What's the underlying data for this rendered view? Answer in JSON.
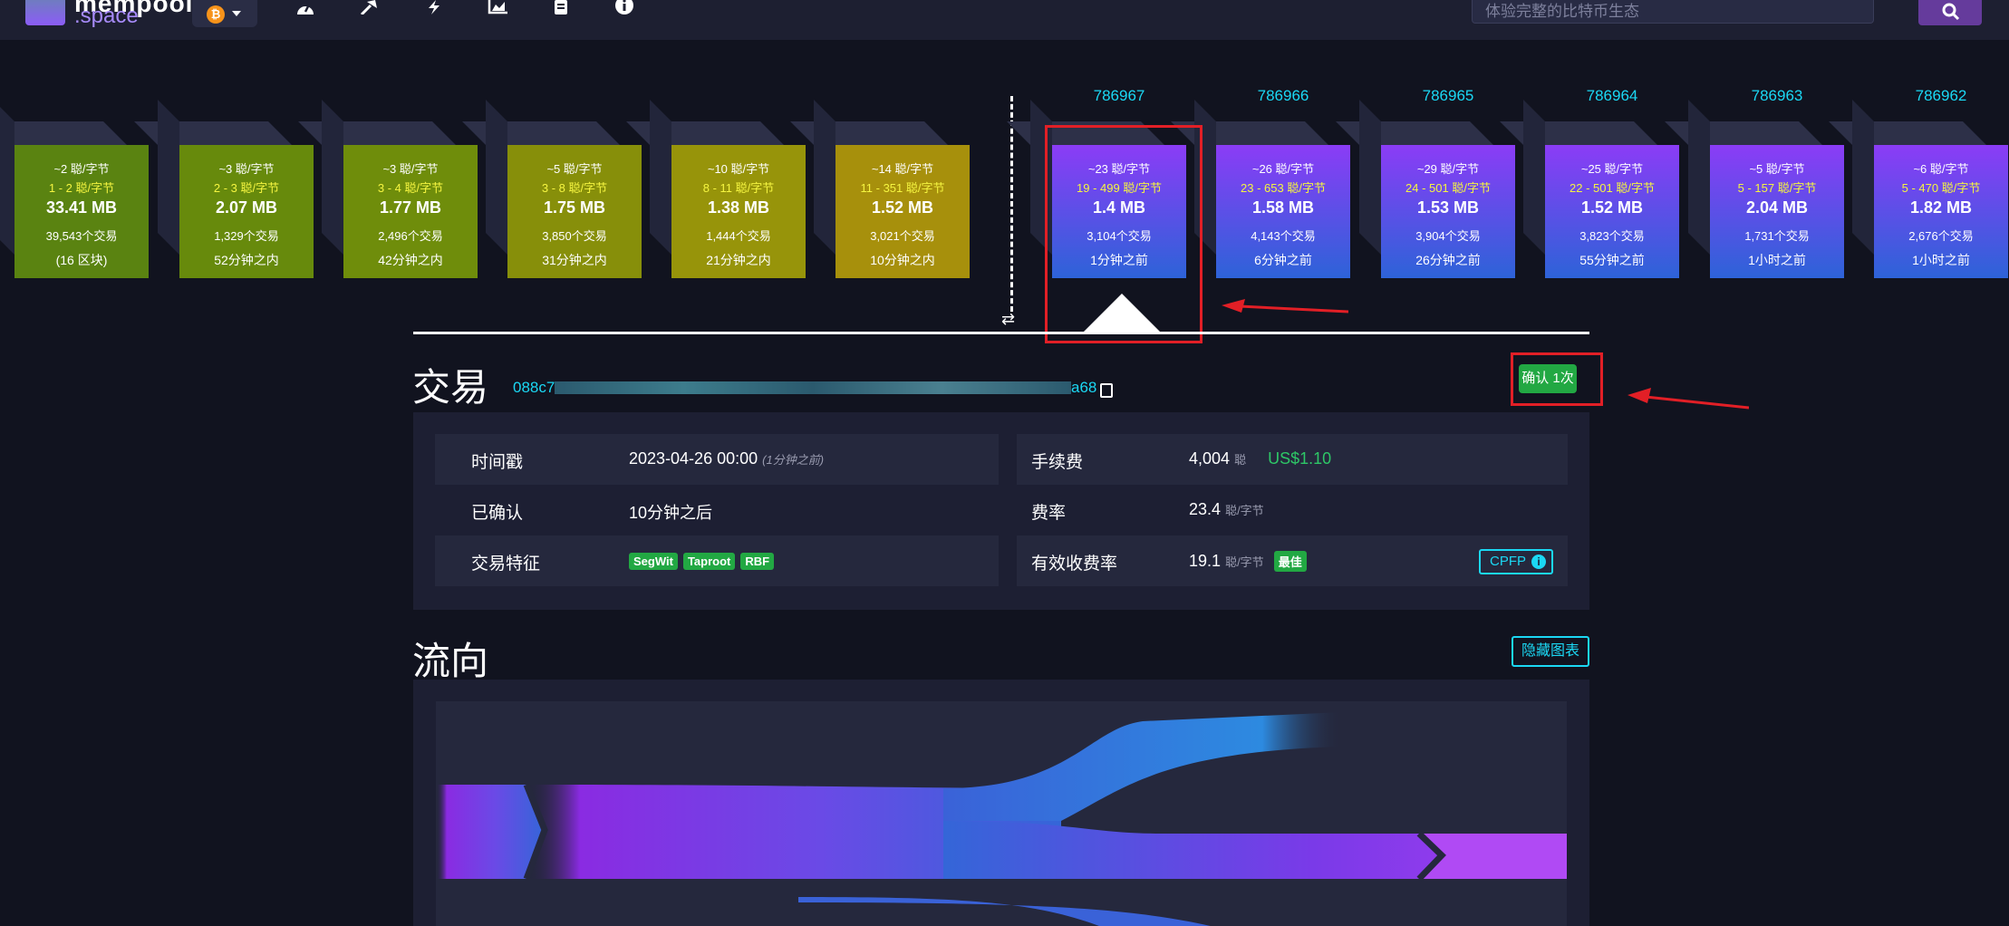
{
  "nav": {
    "logo_top": "mempool",
    "logo_sub": ".space",
    "network_symbol": "₿",
    "icons": [
      "dashboard-icon",
      "mining-icon",
      "lightning-icon",
      "graphs-icon",
      "docs-icon",
      "about-icon"
    ],
    "search_placeholder": "体验完整的比特币生态"
  },
  "mempool_blocks": [
    {
      "fee_median": "~2 聪/字节",
      "fee_range": "1 - 2 聪/字节",
      "size": "33.41 MB",
      "tx_count": "39,543个交易",
      "eta": "(16 区块)",
      "color": "#5a8311",
      "range_color": "#f5f540"
    },
    {
      "fee_median": "~3 聪/字节",
      "fee_range": "2 - 3 聪/字节",
      "size": "2.07 MB",
      "tx_count": "1,329个交易",
      "eta": "52分钟之内",
      "color": "#678a0c",
      "range_color": "#f5f540"
    },
    {
      "fee_median": "~3 聪/字节",
      "fee_range": "3 - 4 聪/字节",
      "size": "1.77 MB",
      "tx_count": "2,496个交易",
      "eta": "42分钟之内",
      "color": "#6f8d0b",
      "range_color": "#f5f540"
    },
    {
      "fee_median": "~5 聪/字节",
      "fee_range": "3 - 8 聪/字节",
      "size": "1.75 MB",
      "tx_count": "3,850个交易",
      "eta": "31分钟之内",
      "color": "#878f0a",
      "range_color": "#f5f540"
    },
    {
      "fee_median": "~10 聪/字节",
      "fee_range": "8 - 11 聪/字节",
      "size": "1.38 MB",
      "tx_count": "1,444个交易",
      "eta": "21分钟之内",
      "color": "#97940a",
      "range_color": "#f5f540"
    },
    {
      "fee_median": "~14 聪/字节",
      "fee_range": "11 - 351 聪/字节",
      "size": "1.52 MB",
      "tx_count": "3,021个交易",
      "eta": "10分钟之内",
      "color": "#a7900c",
      "range_color": "#f5f540"
    }
  ],
  "blocks": [
    {
      "height": "786967",
      "fee_median": "~23 聪/字节",
      "fee_range": "19 - 499 聪/字节",
      "size": "1.4 MB",
      "tx_count": "3,104个交易",
      "time": "1分钟之前"
    },
    {
      "height": "786966",
      "fee_median": "~26 聪/字节",
      "fee_range": "23 - 653 聪/字节",
      "size": "1.58 MB",
      "tx_count": "4,143个交易",
      "time": "6分钟之前"
    },
    {
      "height": "786965",
      "fee_median": "~29 聪/字节",
      "fee_range": "24 - 501 聪/字节",
      "size": "1.53 MB",
      "tx_count": "3,904个交易",
      "time": "26分钟之前"
    },
    {
      "height": "786964",
      "fee_median": "~25 聪/字节",
      "fee_range": "22 - 501 聪/字节",
      "size": "1.52 MB",
      "tx_count": "3,823个交易",
      "time": "55分钟之前"
    },
    {
      "height": "786963",
      "fee_median": "~5 聪/字节",
      "fee_range": "5 - 157 聪/字节",
      "size": "2.04 MB",
      "tx_count": "1,731个交易",
      "time": "1小时之前"
    },
    {
      "height": "786962",
      "fee_median": "~6 聪/字节",
      "fee_range": "5 - 470 聪/字节",
      "size": "1.82 MB",
      "tx_count": "2,676个交易",
      "time": "1小时之前"
    }
  ],
  "transaction": {
    "title": "交易",
    "txid_start": "088c7",
    "txid_end": "a68",
    "confirm_label": "确认 1次",
    "timestamp_label": "时间戳",
    "timestamp_value": "2023-04-26 00:00",
    "timestamp_ago": "(1分钟之前)",
    "confirmed_label": "已确认",
    "confirmed_value": "10分钟之后",
    "features_label": "交易特征",
    "features": [
      "SegWit",
      "Taproot",
      "RBF"
    ],
    "fee_label": "手续费",
    "fee_value": "4,004",
    "fee_unit": "聪",
    "fee_usd": "US$1.10",
    "feerate_label": "费率",
    "feerate_value": "23.4",
    "feerate_unit": "聪/字节",
    "eff_feerate_label": "有效收费率",
    "eff_feerate_value": "19.1",
    "eff_feerate_unit": "聪/字节",
    "eff_badge": "最佳",
    "cpfp_label": "CPFP"
  },
  "flow": {
    "title": "流向",
    "hide_label": "隐藏图表"
  },
  "colors": {
    "accent": "#1bd8f4",
    "success": "#22a843",
    "highlight": "#e21f26",
    "block_top": "#8b3cf6",
    "block_bottom": "#2d63d8"
  }
}
